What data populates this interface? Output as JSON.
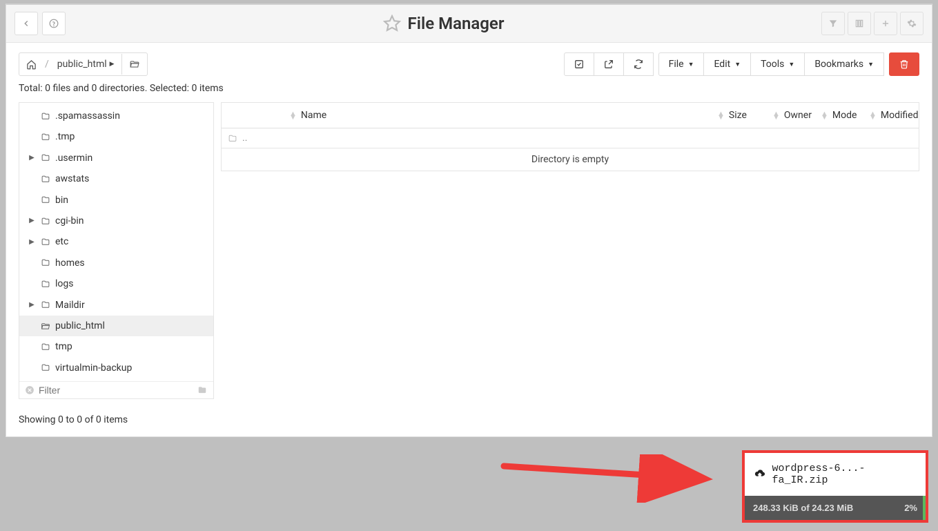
{
  "header": {
    "title": "File Manager"
  },
  "breadcrumb": {
    "home_icon": "home",
    "path": "public_html"
  },
  "toolbar": {
    "file": "File",
    "edit": "Edit",
    "tools": "Tools",
    "bookmarks": "Bookmarks"
  },
  "status": "Total: 0 files and 0 directories. Selected: 0 items",
  "tree": {
    "filter_placeholder": "Filter",
    "items": [
      {
        "name": ".spamassassin",
        "expandable": false
      },
      {
        "name": ".tmp",
        "expandable": false
      },
      {
        "name": ".usermin",
        "expandable": true
      },
      {
        "name": "awstats",
        "expandable": false
      },
      {
        "name": "bin",
        "expandable": false
      },
      {
        "name": "cgi-bin",
        "expandable": true
      },
      {
        "name": "etc",
        "expandable": true
      },
      {
        "name": "homes",
        "expandable": false
      },
      {
        "name": "logs",
        "expandable": false
      },
      {
        "name": "Maildir",
        "expandable": true
      },
      {
        "name": "public_html",
        "expandable": false,
        "active": true,
        "open": true
      },
      {
        "name": "tmp",
        "expandable": false
      },
      {
        "name": "virtualmin-backup",
        "expandable": false
      }
    ]
  },
  "table": {
    "columns": {
      "name": "Name",
      "size": "Size",
      "owner": "Owner",
      "mode": "Mode",
      "modified": "Modified"
    },
    "parent_row": "..",
    "empty_message": "Directory is empty"
  },
  "footer": "Showing 0 to 0 of 0 items",
  "upload": {
    "filename": "wordpress-6...-fa_IR.zip",
    "progress_text": "248.33 KiB of 24.23 MiB",
    "percent": "2%"
  }
}
